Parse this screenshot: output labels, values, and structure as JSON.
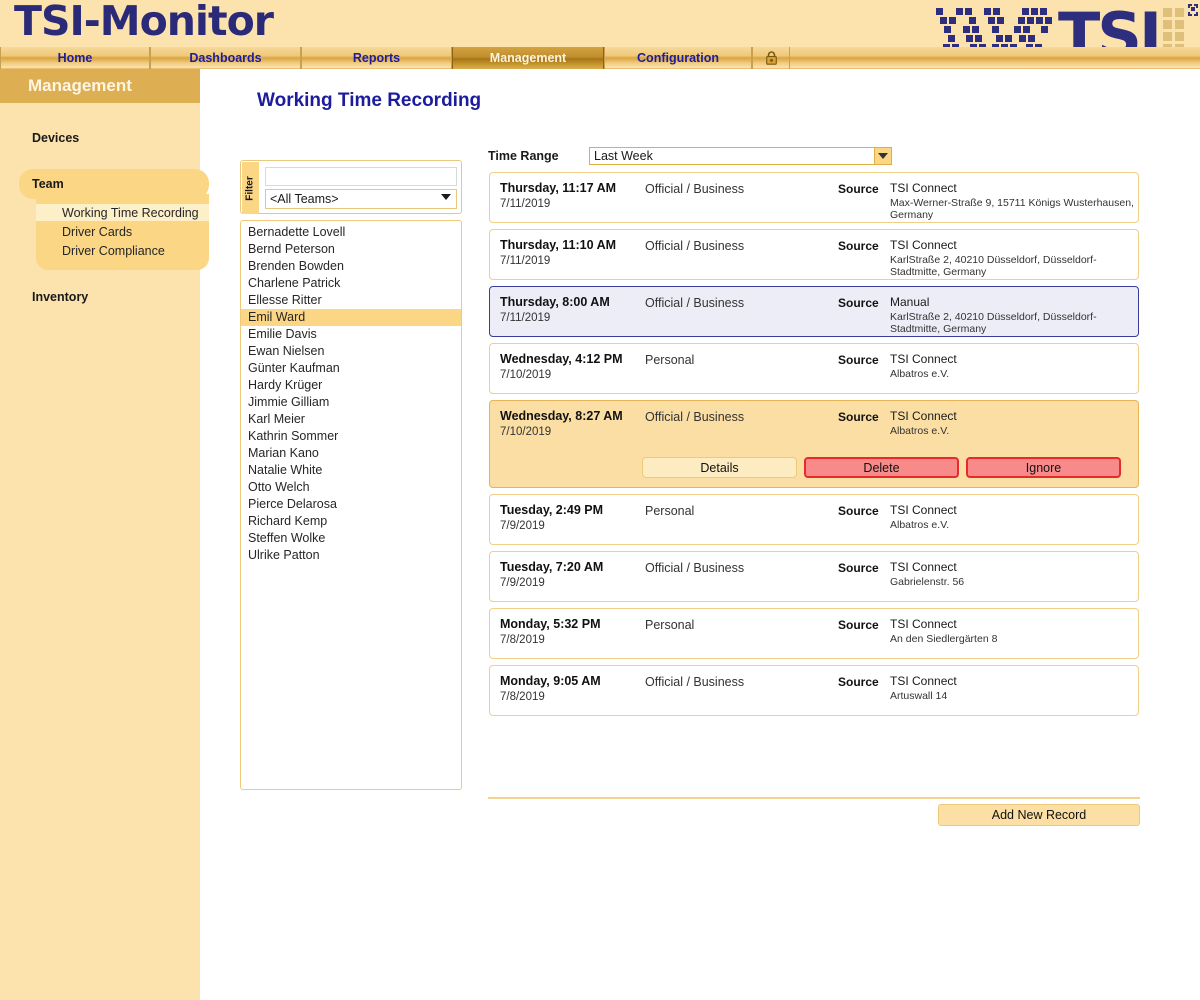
{
  "app": {
    "title": "TSI-Monitor",
    "logo_text": "TSI"
  },
  "nav": {
    "tabs": [
      {
        "label": "Home",
        "active": false
      },
      {
        "label": "Dashboards",
        "active": false
      },
      {
        "label": "Reports",
        "active": false
      },
      {
        "label": "Management",
        "active": true
      },
      {
        "label": "Configuration",
        "active": false
      }
    ],
    "lock_icon": "lock-icon"
  },
  "sidebar": {
    "title": "Management",
    "devices_label": "Devices",
    "team_label": "Team",
    "inventory_label": "Inventory",
    "team_items": [
      {
        "label": "Working Time Recording",
        "selected": true
      },
      {
        "label": "Driver Cards",
        "selected": false
      },
      {
        "label": "Driver Compliance",
        "selected": false
      }
    ]
  },
  "main": {
    "page_title": "Working Time Recording"
  },
  "filter": {
    "label": "Filter",
    "search_value": "",
    "search_placeholder": "",
    "team_select_value": "<All Teams>",
    "caret_icon": "chevron-down-icon"
  },
  "people": [
    {
      "name": "Bernadette Lovell",
      "selected": false
    },
    {
      "name": "Bernd Peterson",
      "selected": false
    },
    {
      "name": "Brenden Bowden",
      "selected": false
    },
    {
      "name": "Charlene Patrick",
      "selected": false
    },
    {
      "name": "Ellesse Ritter",
      "selected": false
    },
    {
      "name": "Emil Ward",
      "selected": true
    },
    {
      "name": "Emilie Davis",
      "selected": false
    },
    {
      "name": "Ewan Nielsen",
      "selected": false
    },
    {
      "name": "Günter Kaufman",
      "selected": false
    },
    {
      "name": "Hardy Krüger",
      "selected": false
    },
    {
      "name": "Jimmie Gilliam",
      "selected": false
    },
    {
      "name": "Karl Meier",
      "selected": false
    },
    {
      "name": "Kathrin Sommer",
      "selected": false
    },
    {
      "name": "Marian Kano",
      "selected": false
    },
    {
      "name": "Natalie White",
      "selected": false
    },
    {
      "name": "Otto Welch",
      "selected": false
    },
    {
      "name": "Pierce Delarosa",
      "selected": false
    },
    {
      "name": "Richard Kemp",
      "selected": false
    },
    {
      "name": "Steffen Wolke",
      "selected": false
    },
    {
      "name": "Ulrike Patton",
      "selected": false
    }
  ],
  "time_range": {
    "label": "Time Range",
    "value": "Last Week",
    "arrow_icon": "chevron-down-icon"
  },
  "records": [
    {
      "day": "Thursday, 11:17 AM",
      "date": "7/11/2019",
      "type": "Official / Business",
      "source_label": "Source",
      "source_name": "TSI Connect",
      "source_address": "Max-Werner-Straße 9,  15711 Königs Wusterhausen,  Germany",
      "state": "normal"
    },
    {
      "day": "Thursday, 11:10 AM",
      "date": "7/11/2019",
      "type": "Official / Business",
      "source_label": "Source",
      "source_name": "TSI Connect",
      "source_address": "KarlStraße 2,  40210 Düsseldorf,  Düsseldorf-Stadtmitte,  Germany",
      "state": "normal"
    },
    {
      "day": "Thursday, 8:00 AM",
      "date": "7/11/2019",
      "type": "Official / Business",
      "source_label": "Source",
      "source_name": "Manual",
      "source_address": "KarlStraße 2,  40210 Düsseldorf,  Düsseldorf-Stadtmitte,  Germany",
      "state": "selected"
    },
    {
      "day": "Wednesday, 4:12 PM",
      "date": "7/10/2019",
      "type": "Personal",
      "source_label": "Source",
      "source_name": "TSI Connect",
      "source_address": "Albatros e.V.",
      "state": "normal"
    },
    {
      "day": "Wednesday, 8:27 AM",
      "date": "7/10/2019",
      "type": "Official / Business",
      "source_label": "Source",
      "source_name": "TSI Connect",
      "source_address": "Albatros e.V.",
      "state": "expanded"
    },
    {
      "day": "Tuesday, 2:49 PM",
      "date": "7/9/2019",
      "type": "Personal",
      "source_label": "Source",
      "source_name": "TSI Connect",
      "source_address": "Albatros e.V.",
      "state": "normal"
    },
    {
      "day": "Tuesday, 7:20 AM",
      "date": "7/9/2019",
      "type": "Official / Business",
      "source_label": "Source",
      "source_name": "TSI Connect",
      "source_address": "Gabrielenstr. 56",
      "state": "normal"
    },
    {
      "day": "Monday, 5:32 PM",
      "date": "7/8/2019",
      "type": "Personal",
      "source_label": "Source",
      "source_name": "TSI Connect",
      "source_address": "An den Siedlergärten 8",
      "state": "normal"
    },
    {
      "day": "Monday, 9:05 AM",
      "date": "7/8/2019",
      "type": "Official / Business",
      "source_label": "Source",
      "source_name": "TSI Connect",
      "source_address": "Artuswall 14",
      "state": "normal"
    }
  ],
  "record_actions": {
    "details_label": "Details",
    "delete_label": "Delete",
    "ignore_label": "Ignore"
  },
  "footer": {
    "add_new_record_label": "Add New Record"
  },
  "colors": {
    "brand_blue": "#2A2A78",
    "header_cream": "#FCE2AC",
    "nav_gold": "#E0B050",
    "active_tab_gold": "#B88A24",
    "highlight_gold": "#FBD684",
    "danger_red": "#E8292E",
    "danger_fill": "#F98A8A",
    "selected_row_blue": "#EDEDF8"
  }
}
